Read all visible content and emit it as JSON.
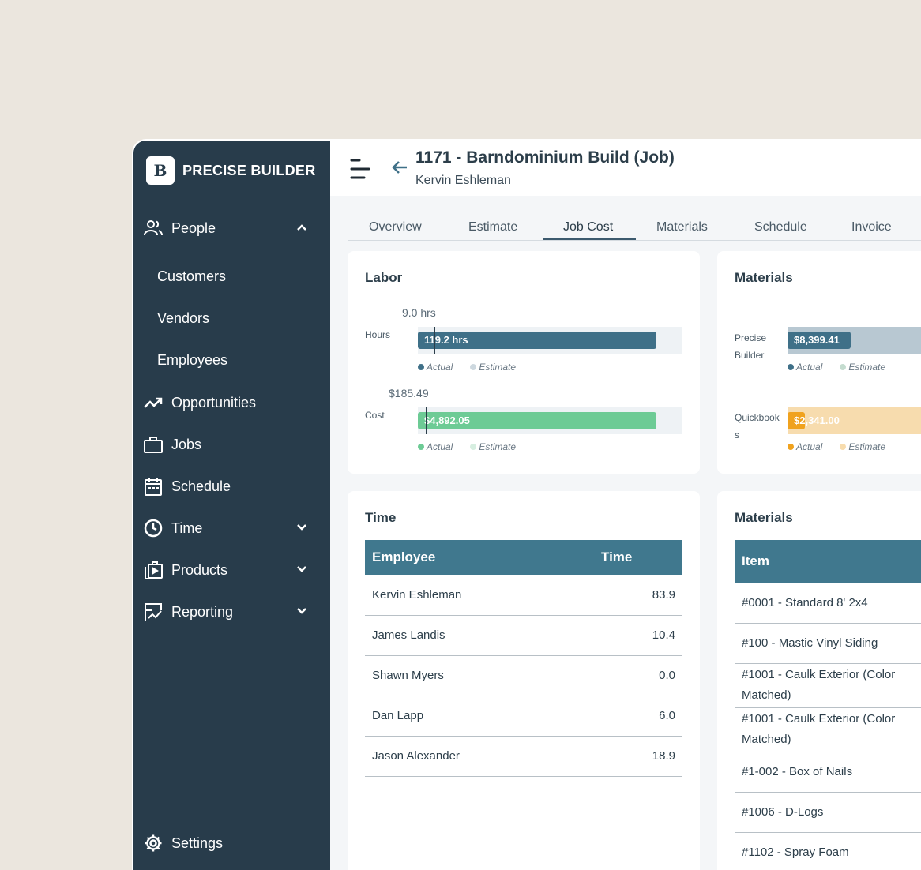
{
  "app": {
    "brand": "PRECISE BUILDER",
    "logo_letter": "B"
  },
  "sidebar": {
    "people": "People",
    "customers": "Customers",
    "vendors": "Vendors",
    "employees": "Employees",
    "opportunities": "Opportunities",
    "jobs": "Jobs",
    "schedule": "Schedule",
    "time": "Time",
    "products": "Products",
    "reporting": "Reporting",
    "settings": "Settings"
  },
  "header": {
    "title": "1171 - Barndominium Build  (Job)",
    "subtitle": "Kervin Eshleman"
  },
  "tabs": [
    "Overview",
    "Estimate",
    "Job Cost",
    "Materials",
    "Schedule",
    "Invoice"
  ],
  "labor": {
    "title": "Labor",
    "hours": {
      "label": "Hours",
      "estimate": "9.0 hrs",
      "actual": "119.2 hrs",
      "fill": 0.9
    },
    "cost": {
      "label": "Cost",
      "estimate": "$185.49",
      "actual": "$4,892.05",
      "fill": 0.9
    },
    "legend_actual": "Actual",
    "legend_estimate": "Estimate"
  },
  "materials_chart": {
    "title": "Materials",
    "precise": {
      "label_1": "Precise",
      "label_2": "Builder",
      "actual": "$8,399.41"
    },
    "quickbooks": {
      "label_1": "Quickbook",
      "label_2": "s",
      "actual": "$2,341.00"
    },
    "legend_actual": "Actual",
    "legend_estimate": "Estimate"
  },
  "time_card": {
    "title": "Time",
    "columns": [
      "Employee",
      "Time"
    ],
    "rows": [
      [
        "Kervin Eshleman",
        "83.9"
      ],
      [
        "James Landis",
        "10.4"
      ],
      [
        "Shawn Myers",
        "0.0"
      ],
      [
        "Dan Lapp",
        "6.0"
      ],
      [
        "Jason Alexander",
        "18.9"
      ]
    ]
  },
  "materials_table": {
    "title": "Materials",
    "column": "Item",
    "rows": [
      "#0001 - Standard 8' 2x4",
      "#100 - Mastic Vinyl Siding",
      "#1001 - Caulk Exterior (Color Matched)",
      "#1001 - Caulk Exterior (Color Matched)",
      "#1-002 - Box of Nails",
      "#1006 - D-Logs",
      "#1102 - Spray Foam"
    ]
  },
  "colors": {
    "sidebar": "#283c4b",
    "labor_hours": "#3f7088",
    "labor_cost": "#6dcb95",
    "materials_precise": "#3f7088",
    "materials_qb": "#f0a21e",
    "table_header": "#40788e"
  }
}
